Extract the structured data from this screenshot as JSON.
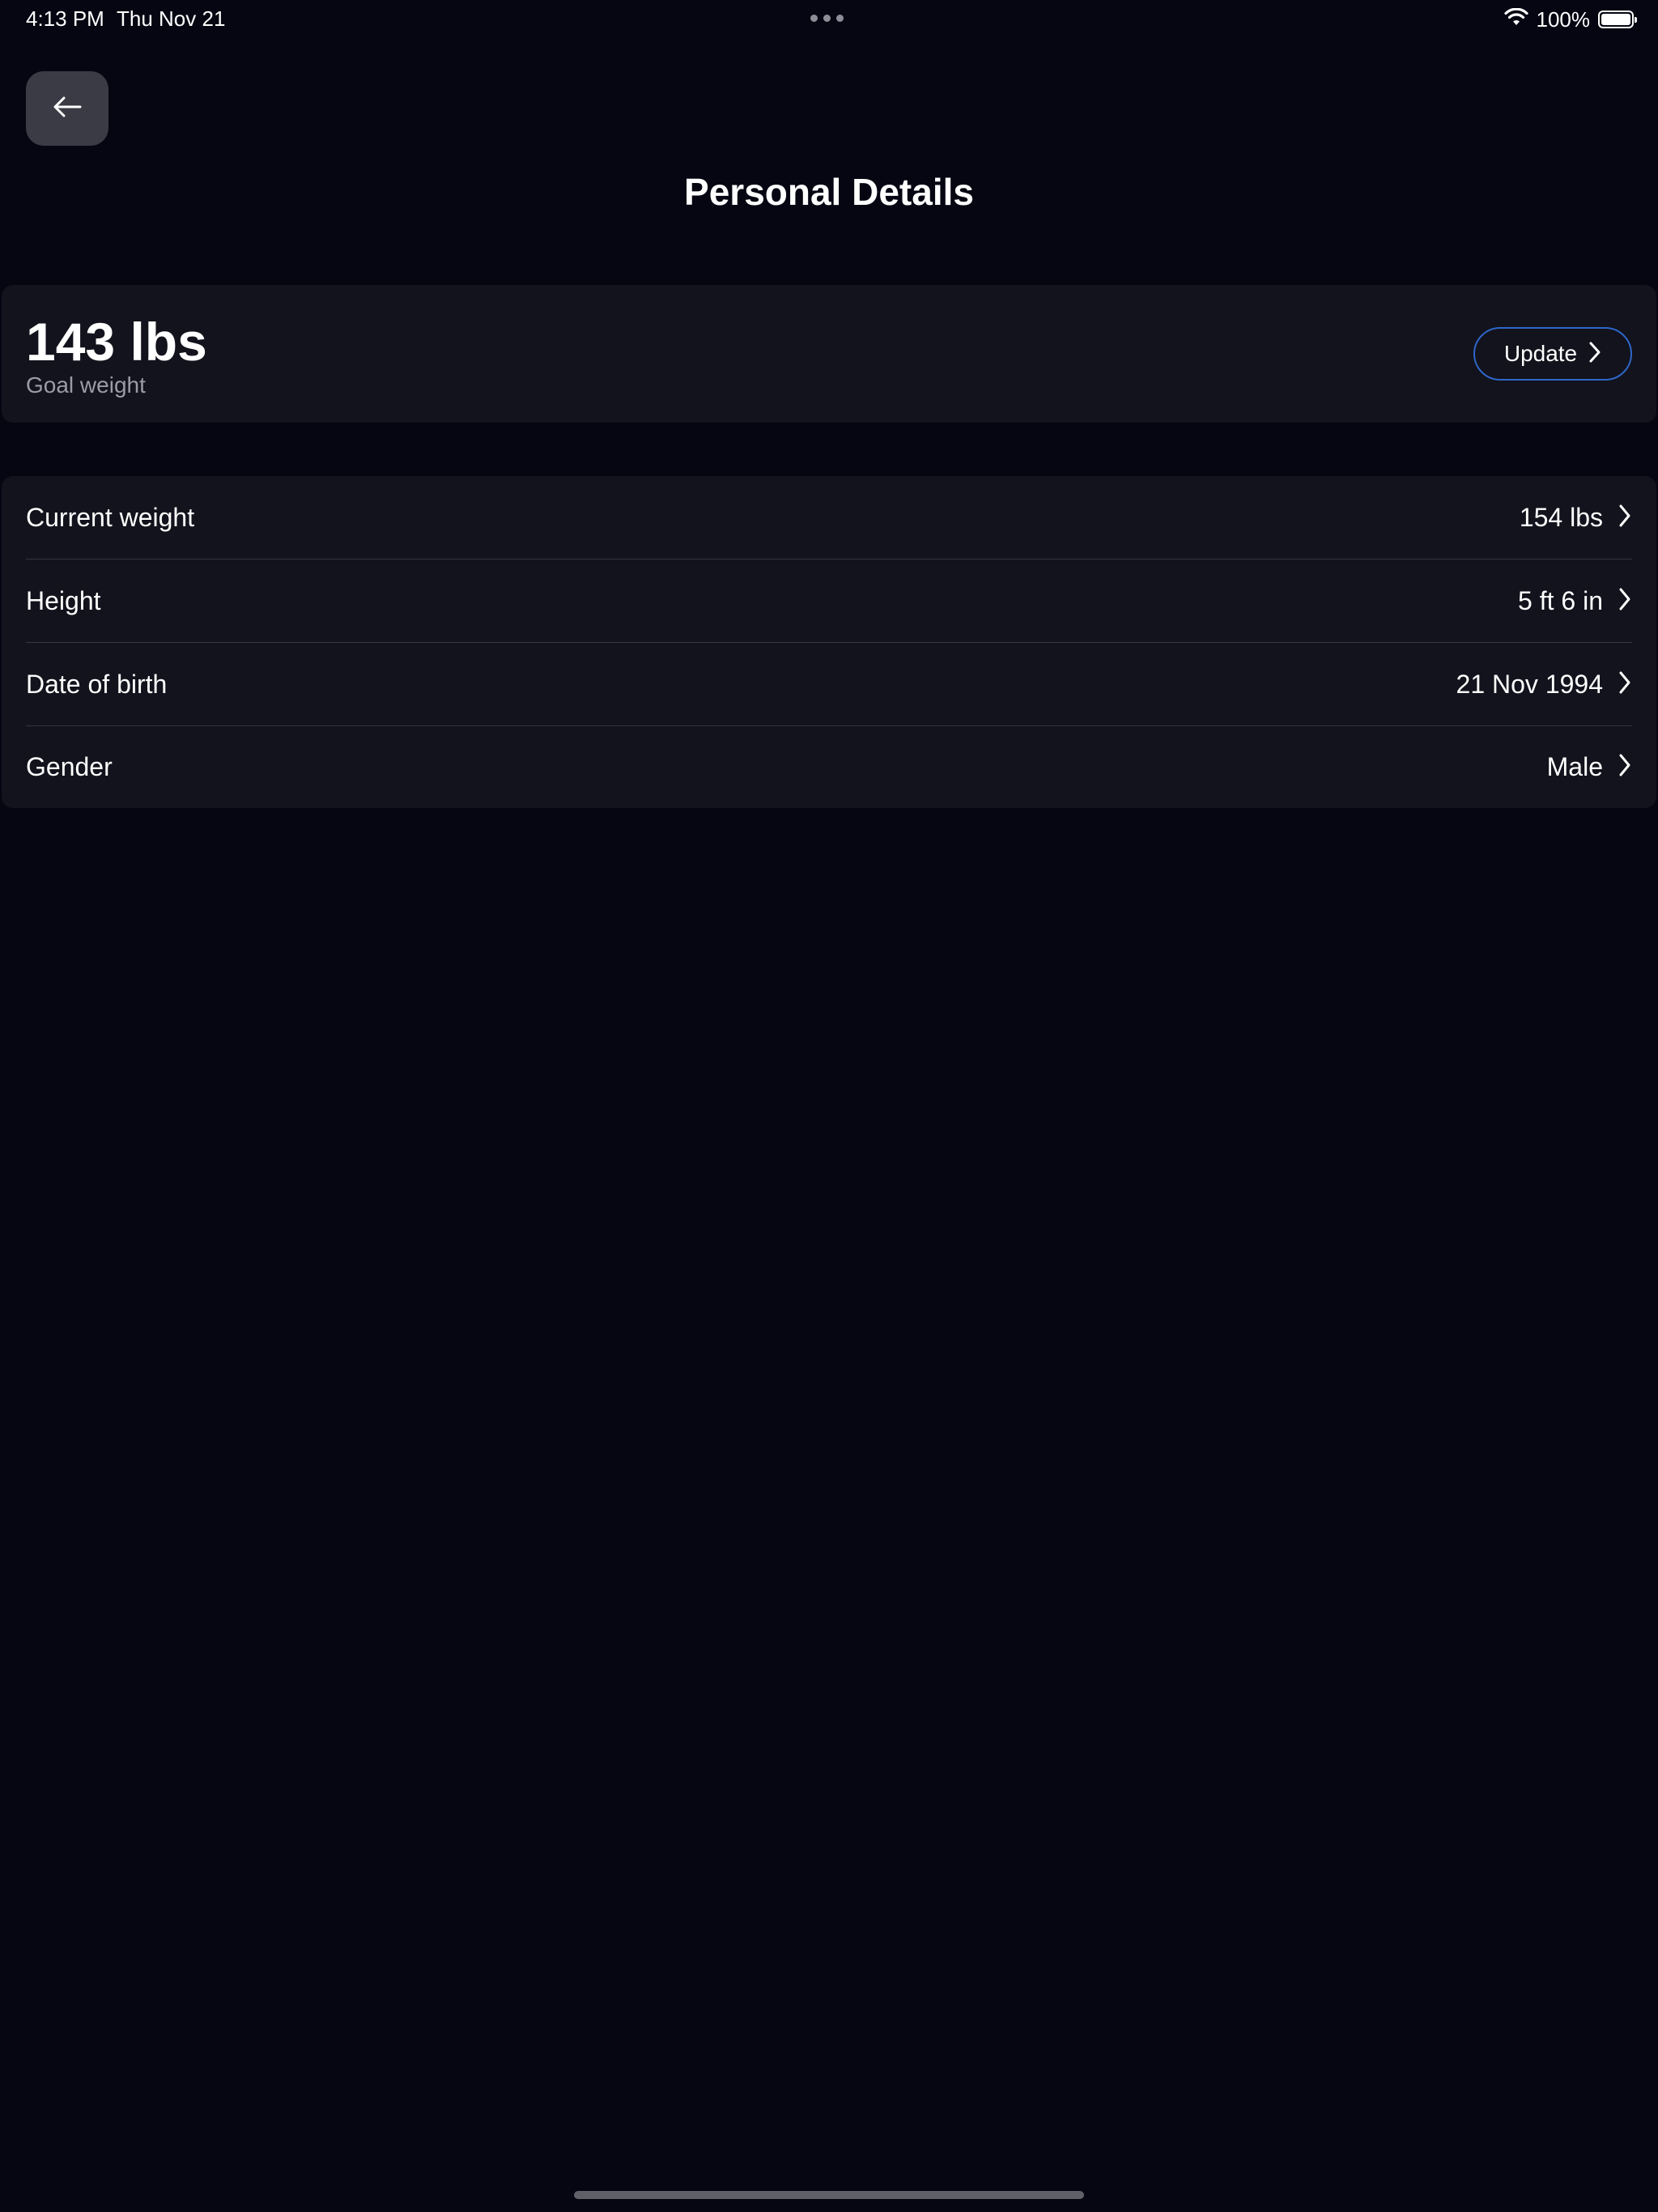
{
  "status_bar": {
    "time": "4:13 PM",
    "date": "Thu Nov 21",
    "battery_percent": "100%",
    "battery_level": 1.0,
    "icons": [
      "multitasking-dots-icon",
      "wifi-icon",
      "battery-icon"
    ]
  },
  "header": {
    "back_icon": "arrow-left-icon",
    "title": "Personal Details"
  },
  "goal": {
    "value": "143 lbs",
    "label": "Goal weight",
    "update_label": "Update",
    "update_icon": "chevron-right-icon"
  },
  "details": {
    "rows": [
      {
        "label": "Current weight",
        "value": "154 lbs"
      },
      {
        "label": "Height",
        "value": "5 ft 6 in"
      },
      {
        "label": "Date of birth",
        "value": "21 Nov 1994"
      },
      {
        "label": "Gender",
        "value": "Male"
      }
    ],
    "row_icon": "chevron-right-icon"
  },
  "colors": {
    "background": "#050612",
    "card": "#12131c",
    "accent_border": "#2f66c9",
    "secondary_text": "#9c9ca6",
    "back_button": "#3a3b44"
  }
}
